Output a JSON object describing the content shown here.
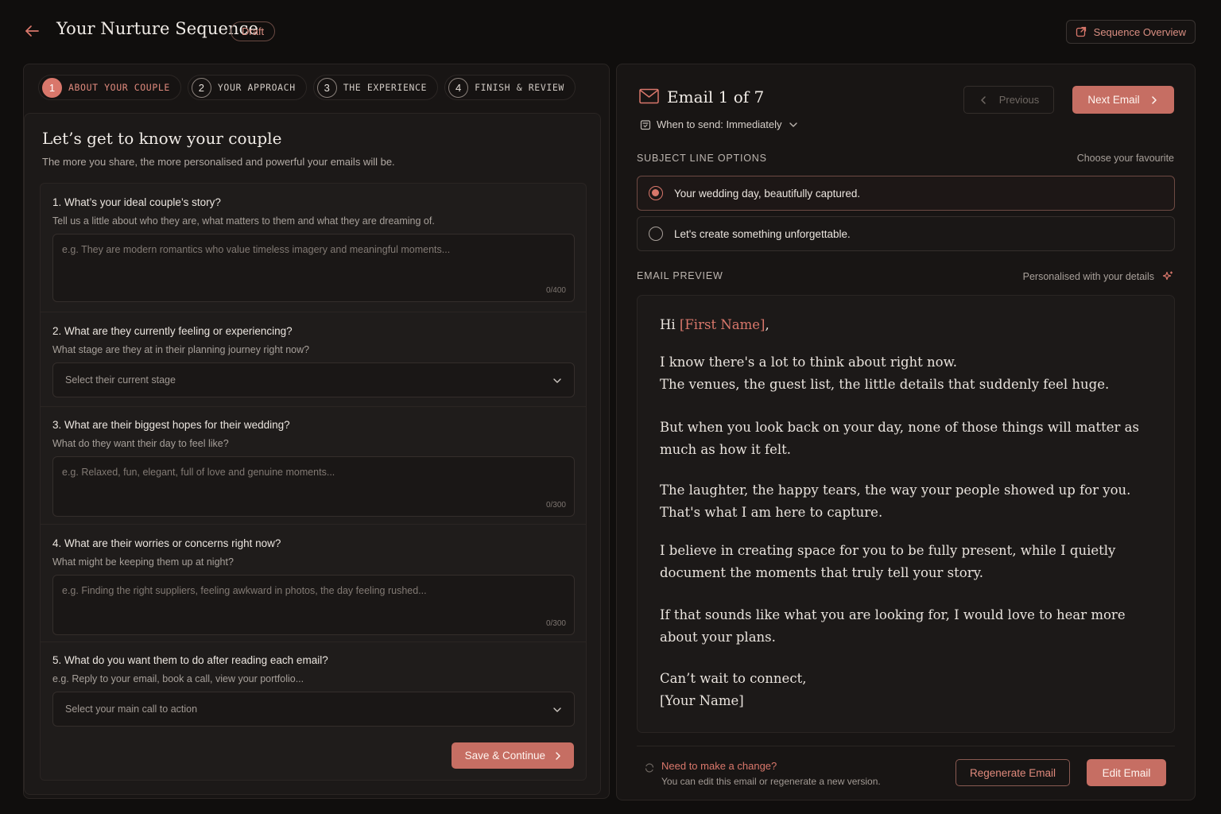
{
  "header": {
    "title": "Your Nurture Sequence",
    "badge": "Draft",
    "overview_button": "Sequence Overview",
    "back_icon": "arrow-left-icon"
  },
  "steps": [
    {
      "num": "1",
      "label": "ABOUT YOUR COUPLE",
      "active": true
    },
    {
      "num": "2",
      "label": "YOUR APPROACH",
      "active": false
    },
    {
      "num": "3",
      "label": "THE EXPERIENCE",
      "active": false
    },
    {
      "num": "4",
      "label": "FINISH & REVIEW",
      "active": false
    }
  ],
  "form": {
    "heading": "Let’s get to know your couple",
    "subheading": "The more you share, the more personalised and powerful your emails will be.",
    "questions": [
      {
        "title": "1. What’s your ideal couple’s story?",
        "help": "Tell us a little about who they are, what matters to them and what they are dreaming of.",
        "placeholder": "e.g. They are modern romantics who value timeless imagery and meaningful moments...",
        "count": "0/400"
      },
      {
        "title": "2. What are they currently feeling or experiencing?",
        "help": "What stage are they at in their planning journey right now?",
        "select_placeholder": "Select their current stage"
      },
      {
        "title": "3. What are their biggest hopes for their wedding?",
        "help": "What do they want their day to feel like?",
        "placeholder": "e.g. Relaxed, fun, elegant, full of love and genuine moments...",
        "count": "0/300"
      },
      {
        "title": "4. What are their worries or concerns right now?",
        "help": "What might be keeping them up at night?",
        "placeholder": "e.g. Finding the right suppliers, feeling awkward in photos, the day feeling rushed...",
        "count": "0/300"
      },
      {
        "title": "5. What do you want them to do after reading each email?",
        "help": "e.g. Reply to your email, book a call, view your portfolio...",
        "select_placeholder": "Select your main call to action"
      }
    ],
    "save_button": "Save & Continue"
  },
  "email": {
    "title": "Email 1 of 7",
    "when_to_send": "When to send: Immediately",
    "previous_button": "Previous",
    "next_button": "Next Email",
    "subject_label": "SUBJECT LINE OPTIONS",
    "subject_hint": "Choose your favourite",
    "subject_options": [
      {
        "text": "Your wedding day, beautifully captured.",
        "selected": true
      },
      {
        "text": "Let's create something unforgettable.",
        "selected": false
      }
    ],
    "preview_label": "EMAIL PREVIEW",
    "preview_hint": "Personalised with your details",
    "body": {
      "greeting": "Hi ",
      "first_name": "[First Name]",
      "greeting_end": ",",
      "lines": [
        "I know there's a lot to think about right now.",
        "The venues, the guest list, the little details that suddenly feel huge.",
        "But when you look back on your day, none of those things will matter as",
        "much as how it felt.",
        "The laughter, the happy tears, the way your people showed up for you.",
        "That's what I am here to capture.",
        "I believe in creating space for you to be fully present, while I quietly",
        "document the moments that truly tell your story.",
        "If that sounds like what you are looking for, I would love to hear more",
        "about your plans.",
        "Can’t wait to connect,"
      ],
      "signature": "[Your Name]"
    },
    "change_title": "Need to make a change?",
    "change_sub": "You can edit this email or regenerate a new version.",
    "regenerate_button": "Regenerate Email",
    "edit_button": "Edit Email"
  },
  "colors": {
    "accent": "#d9776b",
    "button": "#c66e63",
    "background": "#100e0d",
    "panel": "#181514"
  }
}
